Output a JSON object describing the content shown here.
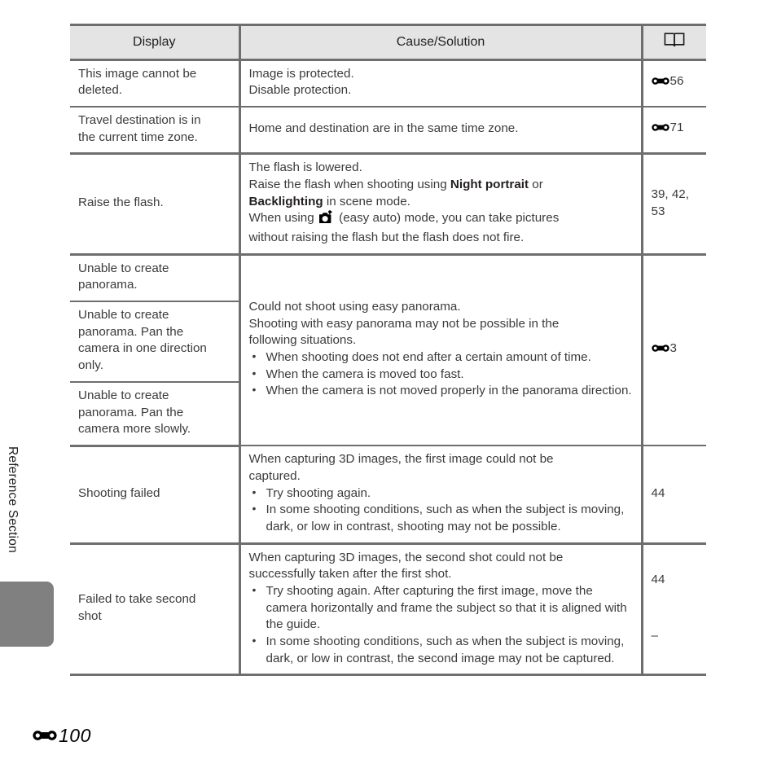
{
  "page": {
    "chapter_label": "Reference Section",
    "footer_icon": "reference-mark-icon",
    "footer_page": "100"
  },
  "table": {
    "headers": {
      "display": "Display",
      "cause_solution": "Cause/Solution",
      "reference": "book-icon"
    },
    "rows": [
      {
        "display_lines": [
          "This image cannot be",
          "deleted."
        ],
        "cause_lines": [
          "Image is protected.",
          "Disable protection."
        ],
        "ref_icon": "reference-mark-icon",
        "ref_value": "56"
      },
      {
        "display_lines": [
          "Travel destination is in",
          "the current time zone."
        ],
        "cause_lines": [
          "Home and destination are in the same time zone."
        ],
        "ref_icon": "reference-mark-icon",
        "ref_value": "71"
      },
      {
        "display_lines": [
          "Raise the flash."
        ],
        "cause_rich": {
          "l1": "The flash is lowered.",
          "l2a": "Raise the flash when shooting using ",
          "l2b": "Night portrait",
          "l2c": " or",
          "l3a": "Backlighting",
          "l3b": " in scene mode.",
          "l4a": "When using ",
          "l4_icon": "easy-auto-camera-icon",
          "l4b": " (easy auto) mode, you can take pictures",
          "l5": "without raising the flash but the flash does not fire."
        },
        "ref_icon": "",
        "ref_value": "39, 42, 53"
      },
      {
        "display_lines": [
          "Unable to create",
          "panorama."
        ],
        "group": "panorama-1"
      },
      {
        "display_lines": [
          "Unable to create",
          "panorama. Pan the",
          "camera in one direction",
          "only."
        ],
        "group": "panorama-2"
      },
      {
        "display_lines": [
          "Unable to create",
          "panorama. Pan the",
          "camera more slowly."
        ],
        "group": "panorama-3"
      },
      {
        "display_lines": [
          "Shooting failed"
        ],
        "cause_intro": [
          "When capturing 3D images, the first image could not be",
          "captured."
        ],
        "cause_bullets": [
          "Try shooting again.",
          "In some shooting conditions, such as when the subject is moving, dark, or low in contrast, shooting may not be possible."
        ],
        "ref_icon": "",
        "ref_value": "44"
      },
      {
        "display_lines": [
          "Failed to take second",
          "shot"
        ],
        "cause_intro": [
          "When capturing 3D images, the second shot could not be",
          "successfully taken after the first shot."
        ],
        "cause_bullets": [
          "Try shooting again. After capturing the first image, move the camera horizontally and frame the subject so that it is aligned with the guide.",
          "In some shooting conditions, such as when the subject is moving, dark, or low in contrast, the second image may not be captured."
        ],
        "ref_icon": "",
        "ref_value": "44",
        "ref_value2": "–"
      }
    ],
    "panorama_cause": {
      "intro": [
        "Could not shoot using easy panorama.",
        "Shooting with easy panorama may not be possible in the",
        "following situations."
      ],
      "bullets": [
        "When shooting does not end after a certain amount of time.",
        "When the camera is moved too fast.",
        "When the camera is not moved properly in the panorama direction."
      ],
      "ref_icon": "reference-mark-icon",
      "ref_value": "3"
    }
  },
  "colors": {
    "header_bg": "#e4e4e4",
    "rule": "#6e6e6e",
    "tab": "#808080",
    "text": "#3b3b3b"
  }
}
